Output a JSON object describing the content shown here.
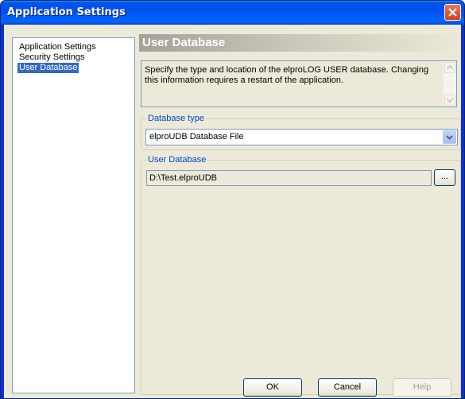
{
  "window": {
    "title": "Application Settings",
    "close_icon": "close-icon"
  },
  "nav": {
    "items": [
      {
        "label": "Application Settings",
        "selected": false
      },
      {
        "label": "Security Settings",
        "selected": false
      },
      {
        "label": "User Database",
        "selected": true
      }
    ]
  },
  "section": {
    "title": "User Database",
    "description": "Specify the type and location of the elproLOG USER database. Changing this information requires a restart of the application."
  },
  "database_type": {
    "label": "Database type",
    "selected": "elproUDB Database File"
  },
  "user_database": {
    "label": "User Database",
    "path": "D:\\Test.elproUDB",
    "browse_label": "..."
  },
  "buttons": {
    "ok": "OK",
    "cancel": "Cancel",
    "help": "Help"
  },
  "colors": {
    "title_bar": "#0054e3",
    "selection": "#316ac5",
    "group_label": "#0046d5",
    "face": "#ece9d8"
  }
}
